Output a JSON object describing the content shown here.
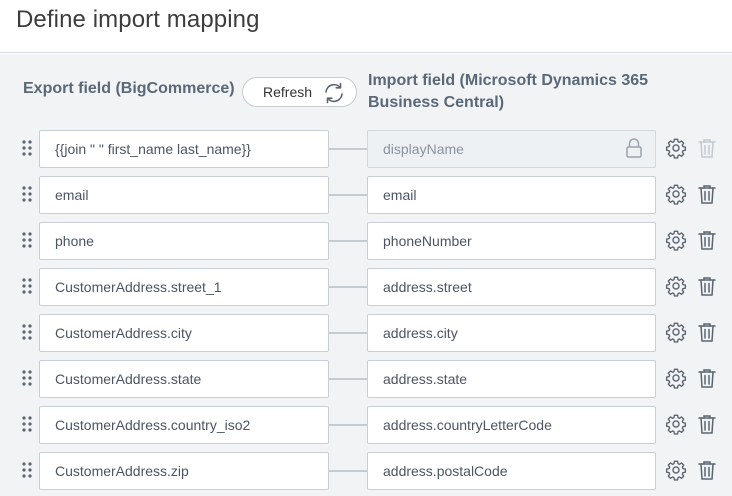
{
  "header": {
    "title": "Define import mapping"
  },
  "columns": {
    "export_title": "Export field (BigCommerce)",
    "import_title": "Import field (Microsoft Dynamics 365 Business Central)"
  },
  "toolbar": {
    "refresh_label": "Refresh"
  },
  "rows": [
    {
      "export": "{{join \" \" first_name last_name}}",
      "import": "displayName",
      "locked": true
    },
    {
      "export": "email",
      "import": "email",
      "locked": false
    },
    {
      "export": "phone",
      "import": "phoneNumber",
      "locked": false
    },
    {
      "export": "CustomerAddress.street_1",
      "import": "address.street",
      "locked": false
    },
    {
      "export": "CustomerAddress.city",
      "import": "address.city",
      "locked": false
    },
    {
      "export": "CustomerAddress.state",
      "import": "address.state",
      "locked": false
    },
    {
      "export": "CustomerAddress.country_iso2",
      "import": "address.countryLetterCode",
      "locked": false
    },
    {
      "export": "CustomerAddress.zip",
      "import": "address.postalCode",
      "locked": false
    }
  ],
  "icons": {
    "drag": "drag-handle-icon",
    "refresh": "refresh-icon",
    "lock": "lock-icon",
    "settings": "gear-icon",
    "delete": "trash-icon"
  },
  "colors": {
    "page_bg": "#f1f3f5",
    "heading": "#5a6878",
    "icon": "#5b6470",
    "icon_disabled": "#c4c9cf",
    "border": "#c9ced5"
  }
}
